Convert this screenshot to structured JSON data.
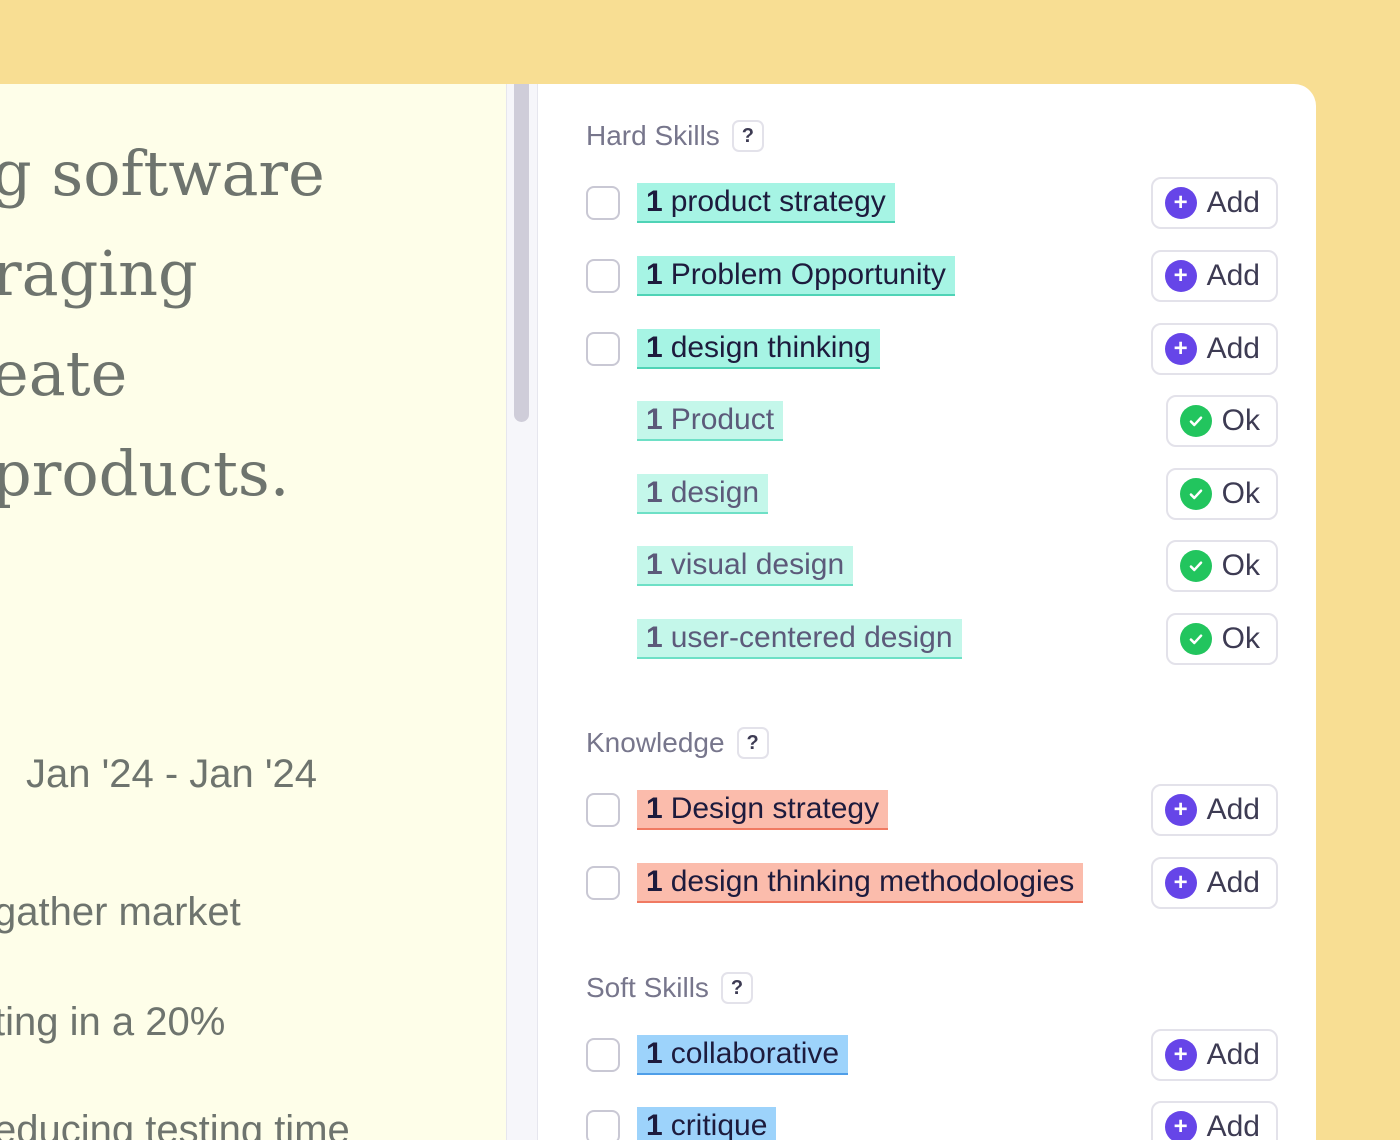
{
  "resume": {
    "heading_lines": [
      "g software",
      "raging",
      "eate",
      "products."
    ],
    "date": "Jan '24 - Jan '24",
    "body_lines": [
      "gather market",
      "ting in a 20%",
      "educing testing time"
    ]
  },
  "sections": {
    "hard": {
      "title": "Hard Skills",
      "help": "?",
      "items": [
        {
          "count": "1",
          "label": "product strategy",
          "action": "Add"
        },
        {
          "count": "1",
          "label": "Problem Opportunity",
          "action": "Add"
        },
        {
          "count": "1",
          "label": "design thinking",
          "action": "Add"
        },
        {
          "count": "1",
          "label": "Product",
          "action": "Ok"
        },
        {
          "count": "1",
          "label": "design",
          "action": "Ok"
        },
        {
          "count": "1",
          "label": "visual design",
          "action": "Ok"
        },
        {
          "count": "1",
          "label": "user-centered design",
          "action": "Ok"
        }
      ]
    },
    "knowledge": {
      "title": "Knowledge",
      "help": "?",
      "items": [
        {
          "count": "1",
          "label": "Design strategy",
          "action": "Add"
        },
        {
          "count": "1",
          "label": "design thinking methodologies",
          "action": "Add"
        }
      ]
    },
    "soft": {
      "title": "Soft Skills",
      "help": "?",
      "items": [
        {
          "count": "1",
          "label": "collaborative",
          "action": "Add"
        },
        {
          "count": "1",
          "label": "critique",
          "action": "Add"
        }
      ]
    }
  },
  "colors": {
    "background": "#f8de93",
    "add_icon": "#6645e8",
    "ok_icon": "#22c55e",
    "hard_tag": "#a6f4e4",
    "knowledge_tag": "#fbbcac",
    "soft_tag": "#9dd3fb"
  },
  "icons": {
    "add": "plus-circle-icon",
    "ok": "check-circle-icon"
  }
}
